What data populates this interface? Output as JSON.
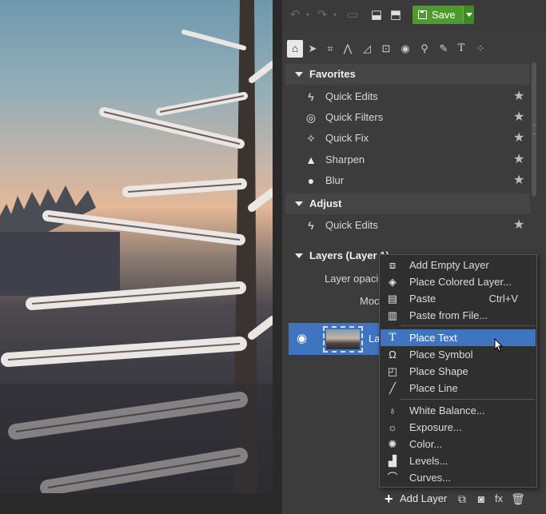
{
  "colors": {
    "accent": "#3e74c0",
    "save_green": "#4f9a2e",
    "panel_bg": "#3c3c3c",
    "menu_bg": "#2f2f2f"
  },
  "toolbar": {
    "undo_icon": "undo-icon",
    "redo_icon": "redo-icon",
    "save_label": "Save"
  },
  "tools": [
    "home-icon",
    "select-icon",
    "crop-icon",
    "perspective-icon",
    "transform-icon",
    "text-box-icon",
    "eye-icon",
    "stamp-icon",
    "brush-icon",
    "text-tool-icon",
    "more-icon"
  ],
  "favorites": {
    "title": "Favorites",
    "items": [
      {
        "label": "Quick Edits",
        "icon": "lightning-icon"
      },
      {
        "label": "Quick Filters",
        "icon": "filters-icon"
      },
      {
        "label": "Quick Fix",
        "icon": "magic-wand-icon"
      },
      {
        "label": "Sharpen",
        "icon": "triangle-icon"
      },
      {
        "label": "Blur",
        "icon": "drop-icon"
      }
    ]
  },
  "adjust": {
    "title": "Adjust",
    "items": [
      {
        "label": "Quick Edits",
        "icon": "lightning-icon"
      }
    ]
  },
  "layers": {
    "title": "Layers (Layer 1)",
    "opacity_label": "Layer opaci",
    "mode_label": "Moc",
    "layer_name": "Lay"
  },
  "menu": {
    "items": [
      {
        "label": "Add Empty Layer",
        "icon": "empty-layer-icon",
        "shortcut": ""
      },
      {
        "label": "Place Colored Layer...",
        "icon": "colored-layer-icon",
        "shortcut": ""
      },
      {
        "label": "Paste",
        "icon": "paste-icon",
        "shortcut": "Ctrl+V"
      },
      {
        "label": "Paste from File...",
        "icon": "paste-file-icon",
        "shortcut": ""
      },
      {
        "label": "Place Text",
        "icon": "text-icon",
        "shortcut": "",
        "highlighted": true
      },
      {
        "label": "Place Symbol",
        "icon": "omega-icon",
        "shortcut": ""
      },
      {
        "label": "Place Shape",
        "icon": "shape-icon",
        "shortcut": ""
      },
      {
        "label": "Place Line",
        "icon": "line-icon",
        "shortcut": ""
      },
      {
        "label": "White Balance...",
        "icon": "bulb-icon",
        "shortcut": ""
      },
      {
        "label": "Exposure...",
        "icon": "sun-icon",
        "shortcut": ""
      },
      {
        "label": "Color...",
        "icon": "palette-icon",
        "shortcut": ""
      },
      {
        "label": "Levels...",
        "icon": "levels-icon",
        "shortcut": ""
      },
      {
        "label": "Curves...",
        "icon": "curves-icon",
        "shortcut": ""
      }
    ]
  },
  "bottombar": {
    "add_layer_label": "Add Layer"
  }
}
